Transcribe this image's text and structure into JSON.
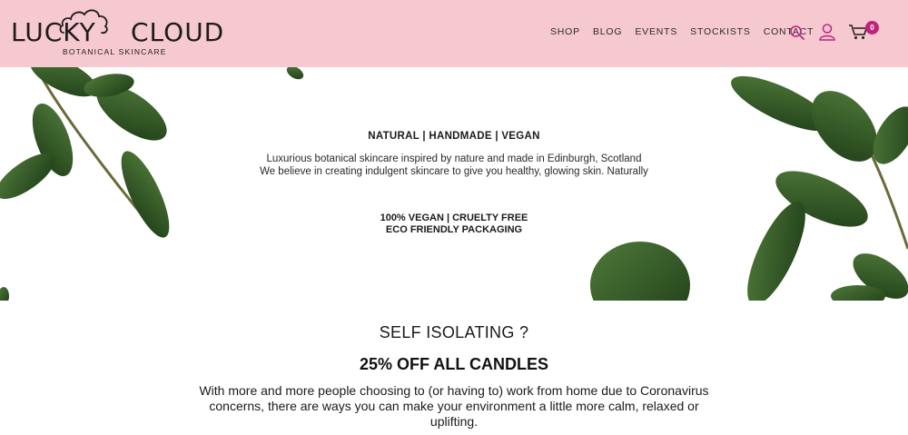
{
  "brand": {
    "name_left": "LUCKY",
    "name_right": "CLOUD",
    "subtitle": "BOTANICAL SKINCARE",
    "header_bg": "#f6c8d0",
    "accent": "#c0237e"
  },
  "nav": {
    "items": [
      "SHOP",
      "BLOG",
      "EVENTS",
      "STOCKISTS",
      "CONTACT"
    ]
  },
  "header_icons": {
    "search": "search-icon",
    "account": "user-icon",
    "cart": "cart-icon",
    "cart_count": "0"
  },
  "hero": {
    "tagline": "NATURAL | HANDMADE | VEGAN",
    "description_line1": "Luxurious botanical skincare inspired by nature and made in Edinburgh, Scotland",
    "description_line2": "We believe in creating indulgent skincare to give you healthy, glowing skin. Naturally",
    "badge_line1": "100% VEGAN | CRUELTY FREE",
    "badge_line2": "ECO FRIENDLY PACKAGING"
  },
  "promo": {
    "title": "SELF ISOLATING ?",
    "subtitle": "25% OFF ALL CANDLES",
    "body": "With more and more people choosing to (or having to) work from home due to Coronavirus concerns, there are ways you can make your environment a little more calm, relaxed or uplifting."
  }
}
